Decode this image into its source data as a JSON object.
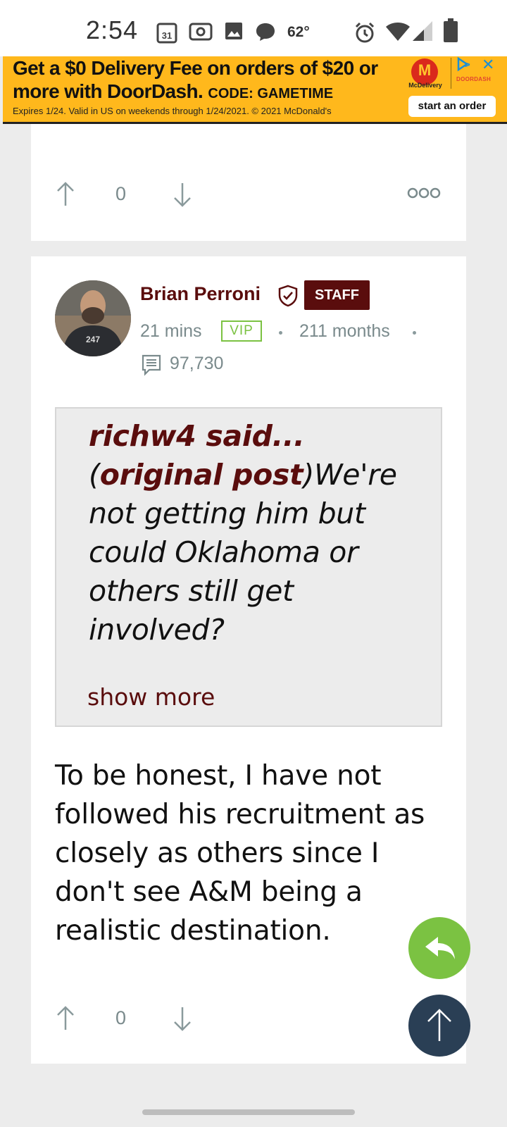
{
  "status_bar": {
    "time": "2:54",
    "calendar_day": "31",
    "temperature": "62°",
    "icons": [
      "calendar-icon",
      "radio-icon",
      "image-icon",
      "chat-bubble-icon",
      "alarm-icon",
      "wifi-icon",
      "signal-icon",
      "battery-icon"
    ]
  },
  "ad": {
    "headline": "Get a $0 Delivery Fee on orders of $20 or more with DoorDash.",
    "code": "CODE: GAMETIME",
    "fineprint": "Expires 1/24. Valid in US on weekends through 1/24/2021. © 2021 McDonald's",
    "mcdelivery_label": "McDelivery",
    "doordash_label": "DOORDASH",
    "cta_label": "start an order",
    "background_color": "#ffb81c"
  },
  "previous_post": {
    "vote_count": "0"
  },
  "post": {
    "author_name": "Brian Perroni",
    "staff_label": "STAFF",
    "posted_ago": "21 mins",
    "vip_label": "VIP",
    "member_duration": "211 months",
    "post_count": "97,730",
    "quote": {
      "author": "richw4 said...",
      "link_label": "original post",
      "text": "We're not getting him but could Oklahoma or others still get involved?",
      "show_more_label": "show more"
    },
    "body": "To be honest, I have not followed his recruitment as closely as others since I don't see A&M being a realistic destination.",
    "vote_count": "0"
  },
  "colors": {
    "brand_maroon": "#5a0d0d",
    "vip_green": "#7bc242",
    "scroll_top_navy": "#2a3f55"
  }
}
